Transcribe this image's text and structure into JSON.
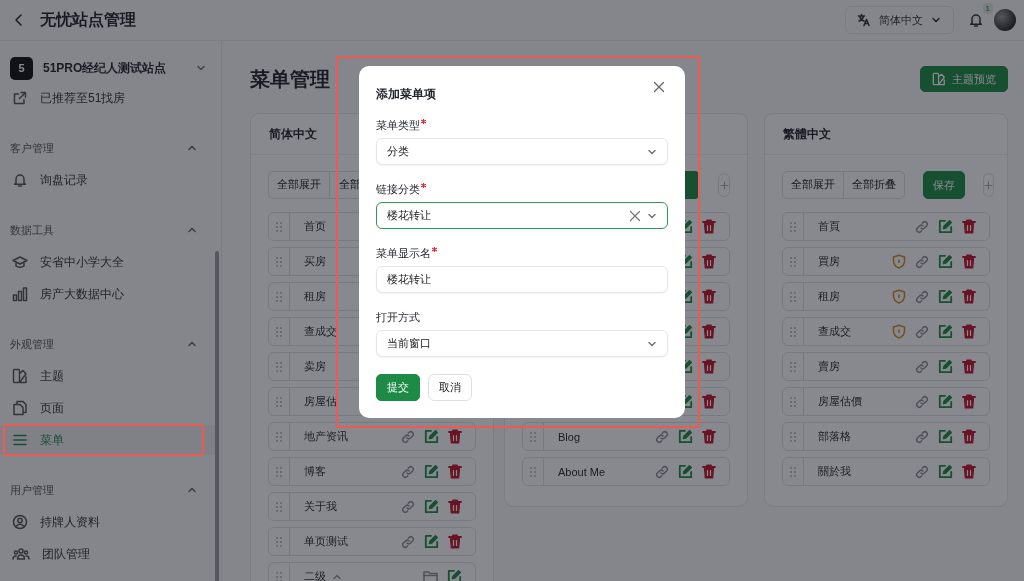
{
  "topbar": {
    "title": "无忧站点管理",
    "language": "简体中文",
    "notification_count": "1"
  },
  "sidebar": {
    "site": {
      "badge": "5",
      "name": "51PRO经纪人测试站点"
    },
    "items": [
      {
        "kind": "link",
        "label": "已推荐至51找房"
      },
      {
        "kind": "group",
        "label": "客户管理",
        "expanded": true,
        "children": [
          {
            "label": "询盘记录",
            "selected": false,
            "highlighted": false
          }
        ]
      },
      {
        "kind": "group",
        "label": "数据工具",
        "expanded": true,
        "children": [
          {
            "label": "安省中小学大全",
            "selected": false,
            "highlighted": false
          },
          {
            "label": "房产大数据中心",
            "selected": false,
            "highlighted": false
          }
        ]
      },
      {
        "kind": "group",
        "label": "外观管理",
        "expanded": true,
        "children": [
          {
            "label": "主题",
            "selected": false,
            "highlighted": false
          },
          {
            "label": "页面",
            "selected": false,
            "highlighted": false
          },
          {
            "label": "菜单",
            "selected": true,
            "highlighted": true
          }
        ]
      },
      {
        "kind": "group",
        "label": "用户管理",
        "expanded": true,
        "children": [
          {
            "label": "持牌人资料",
            "selected": false,
            "highlighted": false
          },
          {
            "label": "团队管理",
            "selected": false,
            "highlighted": false
          }
        ]
      }
    ]
  },
  "page": {
    "title": "菜单管理",
    "preview_button": "主题预览"
  },
  "panels": [
    {
      "title": "简体中文",
      "toolbar": [
        {
          "kind": "plain",
          "label": "全部展开"
        },
        {
          "kind": "plain",
          "label": "全部"
        }
      ],
      "rows": [
        {
          "kind": "item",
          "label": "首页"
        },
        {
          "kind": "item",
          "label": "买房"
        },
        {
          "kind": "item",
          "label": "租房"
        },
        {
          "kind": "item",
          "label": "查成交"
        },
        {
          "kind": "item",
          "label": "卖房"
        },
        {
          "kind": "item",
          "label": "房屋估"
        },
        {
          "kind": "item",
          "label": "地产资讯"
        },
        {
          "kind": "item",
          "label": "博客"
        },
        {
          "kind": "item",
          "label": "关于我"
        },
        {
          "kind": "item",
          "label": "单页测试"
        },
        {
          "kind": "group",
          "label": "二级",
          "expanded": true
        }
      ]
    },
    {
      "toolbar": [
        {
          "kind": "primary"
        },
        {
          "kind": "add"
        }
      ],
      "rows": [
        {
          "kind": "item"
        },
        {
          "kind": "item"
        },
        {
          "kind": "item"
        },
        {
          "kind": "item"
        },
        {
          "kind": "item"
        },
        {
          "kind": "item"
        },
        {
          "kind": "item",
          "label": "Blog"
        },
        {
          "kind": "item",
          "label": "About Me"
        }
      ]
    },
    {
      "title": "繁體中文",
      "toolbar": [
        {
          "kind": "plain",
          "label": "全部展开"
        },
        {
          "kind": "plain",
          "label": "全部折叠"
        },
        {
          "kind": "primary",
          "label": "保存"
        },
        {
          "kind": "add"
        }
      ],
      "rows": [
        {
          "kind": "item",
          "label": "首頁"
        },
        {
          "kind": "protected",
          "label": "買房"
        },
        {
          "kind": "protected",
          "label": "租房"
        },
        {
          "kind": "protected",
          "label": "查成交"
        },
        {
          "kind": "item",
          "label": "賣房"
        },
        {
          "kind": "item",
          "label": "房屋估價"
        },
        {
          "kind": "item",
          "label": "部落格"
        },
        {
          "kind": "item",
          "label": "關於我"
        }
      ]
    }
  ],
  "dialog": {
    "title": "添加菜单项",
    "highlighted": true,
    "fields": [
      {
        "kind": "select",
        "label": "菜单类型",
        "required": true,
        "value": "分类",
        "focused": false
      },
      {
        "kind": "select",
        "label": "链接分类",
        "required": true,
        "value": "楼花转让",
        "focused": true
      },
      {
        "kind": "input",
        "label": "菜单显示名",
        "required": true,
        "value": "楼花转让",
        "focused": false
      },
      {
        "kind": "select",
        "label": "打开方式",
        "required": false,
        "value": "当前窗口",
        "focused": false
      }
    ],
    "buttons": [
      {
        "kind": "primary",
        "label": "提交"
      },
      {
        "kind": "plain",
        "label": "取消"
      }
    ]
  }
}
